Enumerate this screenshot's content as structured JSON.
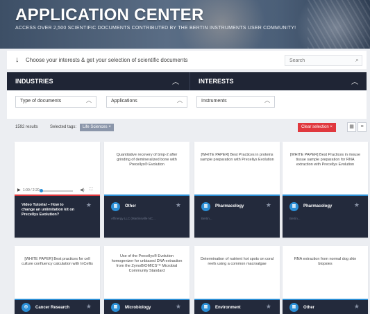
{
  "hero": {
    "title": "APPLICATION CENTER",
    "subtitle": "ACCESS OVER 2,500 SCIENTIFIC DOCUMENTS CONTRIBUTED BY THE BERTIN INSTRUMENTS USER COMMUNITY!"
  },
  "choose": {
    "text": "Choose your interests & get your selection of scientific documents",
    "search_placeholder": "Search"
  },
  "filters": {
    "industries_label": "INDUSTRIES",
    "interests_label": "INTERESTS",
    "dropdowns": {
      "type_of_documents": "Type of documents",
      "applications": "Applications",
      "instruments": "Instruments"
    }
  },
  "results": {
    "count": "1592 results",
    "selected_tags_label": "Selected tags:",
    "tag": "Life Sciences ×",
    "clear_selection": "Clear selection ×"
  },
  "cards": [
    {
      "type": "video",
      "player_time": "1:00 / 2:20",
      "title": "Video Tutorial – How to change an unlimitation kit on Precellys Evolution?"
    },
    {
      "title": "Quantitative recovery of bmp-2 after grinding of demineralized bone with Precellys® Evolution",
      "category": "Other",
      "meta": "Affinergy LLC (Martinsville NC..."
    },
    {
      "title": "[WHITE PAPER] Best Practices in proteins sample preparation with Precellys Evolution",
      "category": "Pharmacology",
      "meta": "Bertin..."
    },
    {
      "title": "[WHITE PAPER] Best Practices in mouse tissue sample preparation for RNA extraction with Precellys Evolution",
      "category": "Pharmacology",
      "meta": "Bertin..."
    },
    {
      "title": "[WHITE PAPER] Best practices for cell culture confluency calculation with InCellis",
      "category": "Cancer Research"
    },
    {
      "title": "Use of the Precellys® Evolution homogenizer for unbiased DNA extraction from the ZymoBIOMICS™ Microbial Community Standard",
      "category": "Microbiology"
    },
    {
      "title": "Determination of nutrient hot spots on coral reefs using a common macroalgae",
      "category": "Environment"
    },
    {
      "title": "RNA extraction from normal dog skin biopsies",
      "category": "Other"
    }
  ],
  "colors": {
    "dark_header": "#1f2535",
    "accent_blue": "#2b8fd6",
    "clear_red": "#e0383e",
    "tag_grey": "#8b96aa"
  }
}
